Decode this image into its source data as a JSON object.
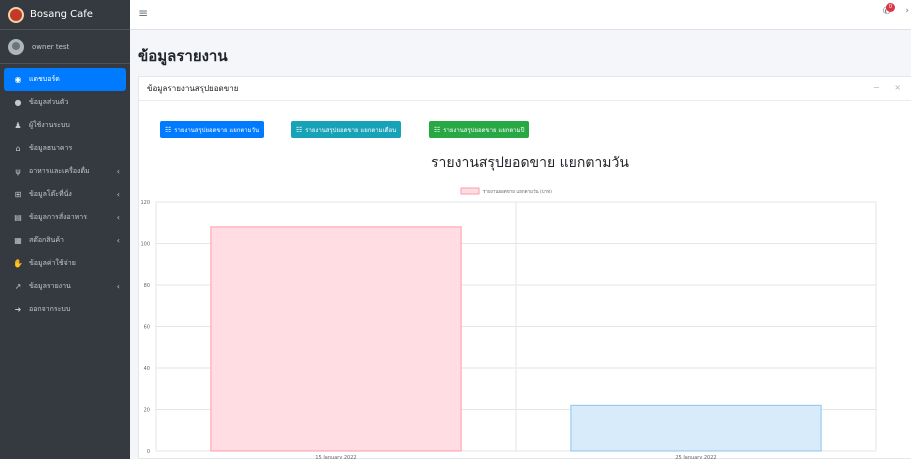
{
  "brand": {
    "name": "Bosang Cafe"
  },
  "user": {
    "name": "owner test"
  },
  "sidebar": {
    "items": [
      {
        "label": "แดชบอร์ด",
        "icon": "dashboard-icon",
        "glyph": "◉",
        "active": true,
        "arrow": false
      },
      {
        "label": "ข้อมูลส่วนตัว",
        "icon": "user-circle-icon",
        "glyph": "●",
        "active": false,
        "arrow": false
      },
      {
        "label": "ผู้ใช้งานระบบ",
        "icon": "users-icon",
        "glyph": "♟",
        "active": false,
        "arrow": false
      },
      {
        "label": "ข้อมูลธนาคาร",
        "icon": "bank-icon",
        "glyph": "⌂",
        "active": false,
        "arrow": false
      },
      {
        "label": "อาหารและเครื่องดื่ม",
        "icon": "utensils-icon",
        "glyph": "ψ",
        "active": false,
        "arrow": true
      },
      {
        "label": "ข้อมูลโต๊ะที่นั่ง",
        "icon": "table-icon",
        "glyph": "⊞",
        "active": false,
        "arrow": true
      },
      {
        "label": "ข้อมูลการสั่งอาหาร",
        "icon": "receipt-icon",
        "glyph": "▤",
        "active": false,
        "arrow": true
      },
      {
        "label": "สต๊อกสินค้า",
        "icon": "boxes-icon",
        "glyph": "▦",
        "active": false,
        "arrow": true
      },
      {
        "label": "ข้อมูลค่าใช้จ่าย",
        "icon": "money-hand-icon",
        "glyph": "✋",
        "active": false,
        "arrow": false
      },
      {
        "label": "ข้อมูลรายงาน",
        "icon": "line-chart-icon",
        "glyph": "↗",
        "active": false,
        "arrow": true
      },
      {
        "label": "ออกจากระบบ",
        "icon": "sign-out-icon",
        "glyph": "➜",
        "active": false,
        "arrow": false
      }
    ],
    "arrow_glyph": "‹"
  },
  "topbar": {
    "menu_glyph": "≡",
    "bell_glyph": "✆",
    "badge": "0",
    "edge_glyph": "›"
  },
  "page": {
    "title": "ข้อมูลรายงาน"
  },
  "card": {
    "title": "ข้อมูลรายงานสรุปยอดขาย",
    "tools": "− ×"
  },
  "buttons": {
    "daily": "รายงานสรุปยอดขาย แยกตามวัน",
    "monthly": "รายงานสรุปยอดขาย แยกตามเดือน",
    "yearly": "รายงานสรุปยอดขาย แยกตามปี",
    "icon_glyph": "☷"
  },
  "report": {
    "title": "รายงานสรุปยอดขาย แยกตามวัน"
  },
  "chart_data": {
    "type": "bar",
    "categories": [
      "15 January 2022",
      "25 January 2022"
    ],
    "series": [
      {
        "name": "รายงานยอดขาย แยกตามวัน (บาท)",
        "values": [
          108,
          22
        ]
      }
    ],
    "bar_colors": [
      {
        "fill": "#ffdde3",
        "stroke": "#ff9aad"
      },
      {
        "fill": "#d7ebfa",
        "stroke": "#8cc4ee"
      }
    ],
    "legend_color": {
      "fill": "#ffdde3",
      "stroke": "#ff9aad"
    },
    "ylim": [
      0,
      120
    ],
    "yticks": [
      0,
      20,
      40,
      60,
      80,
      100,
      120
    ],
    "legend_position": "top-center",
    "grid": true
  }
}
